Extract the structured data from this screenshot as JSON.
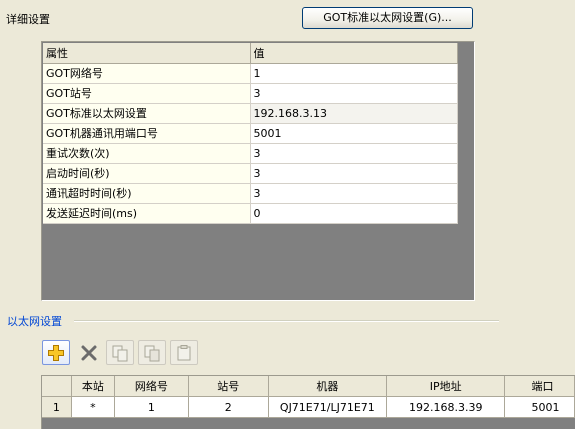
{
  "detail": {
    "title": "详细设置",
    "got_button_label": "GOT标准以太网设置(G)..."
  },
  "property_table": {
    "headers": [
      "属性",
      "值"
    ],
    "rows": [
      [
        "GOT网络号",
        "1"
      ],
      [
        "GOT站号",
        "3"
      ],
      [
        "GOT标准以太网设置",
        "192.168.3.13"
      ],
      [
        "GOT机器通讯用端口号",
        "5001"
      ],
      [
        "重试次数(次)",
        "3"
      ],
      [
        "启动时间(秒)",
        "3"
      ],
      [
        "通讯超时时间(秒)",
        "3"
      ],
      [
        "发送延迟时间(ms)",
        "0"
      ]
    ]
  },
  "ethernet": {
    "title": "以太网设置",
    "toolbar": [
      {
        "icon": "add-icon",
        "state": "enabled"
      },
      {
        "icon": "delete-icon",
        "state": "enabled"
      },
      {
        "icon": "copy-icon",
        "state": "disabled"
      },
      {
        "icon": "paste-icon",
        "state": "disabled"
      },
      {
        "icon": "clipboard-icon",
        "state": "disabled"
      }
    ],
    "headers": [
      "",
      "本站",
      "网络号",
      "站号",
      "机器",
      "IP地址",
      "端口"
    ],
    "rows": [
      [
        "1",
        "*",
        "1",
        "2",
        "QJ71E71/LJ71E71",
        "192.168.3.39",
        "5001"
      ]
    ]
  }
}
